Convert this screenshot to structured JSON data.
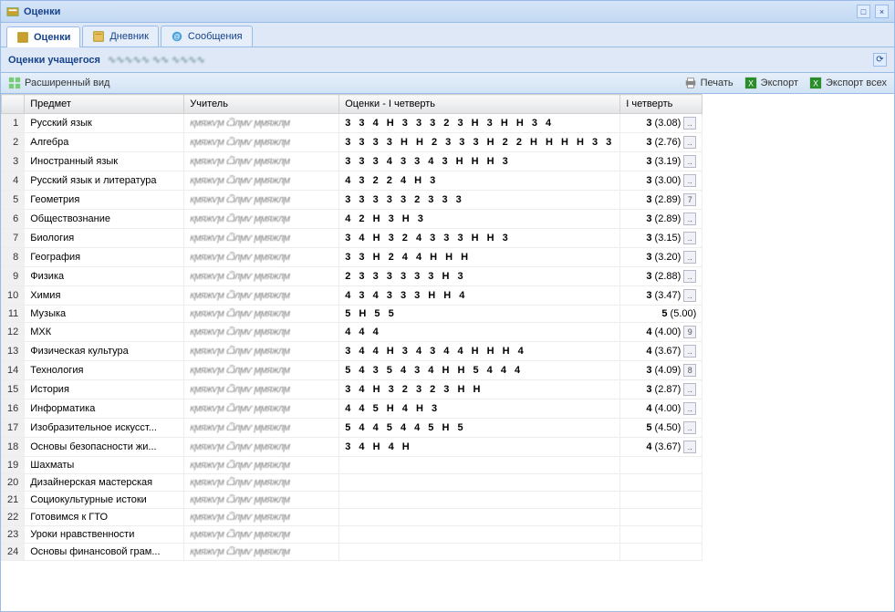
{
  "window_title": "Оценки",
  "tabs": [
    {
      "label": "Оценки",
      "active": true,
      "icon": "grades-icon"
    },
    {
      "label": "Дневник",
      "active": false,
      "icon": "diary-icon"
    },
    {
      "label": "Сообщения",
      "active": false,
      "icon": "messages-icon"
    }
  ],
  "subheader": "Оценки учащегося",
  "toolbar": {
    "expanded": "Расширенный вид",
    "print": "Печать",
    "export": "Экспорт",
    "export_all": "Экспорт всех"
  },
  "columns": {
    "subject": "Предмет",
    "teacher": "Учитель",
    "marks": "Оценки - I четверть",
    "quarter": "I четверть"
  },
  "rows": [
    {
      "n": 1,
      "subject": "Русский язык",
      "marks": "3 3 4 Н 3 3 3 2 3 Н 3 Н Н 3 4",
      "q": "3",
      "avg": "(3.08)",
      "ex": ".."
    },
    {
      "n": 2,
      "subject": "Алгебра",
      "marks": "3 3 3 3 Н Н 2 3 3 3 Н 2 2 Н Н Н Н 3 3",
      "q": "3",
      "avg": "(2.76)",
      "ex": ".."
    },
    {
      "n": 3,
      "subject": "Иностранный язык",
      "marks": "3 3 3 4 3 3 4 3 Н Н Н 3",
      "q": "3",
      "avg": "(3.19)",
      "ex": ".."
    },
    {
      "n": 4,
      "subject": "Русский язык и литература",
      "marks": "4 3 2 2 4 Н 3",
      "q": "3",
      "avg": "(3.00)",
      "ex": ".."
    },
    {
      "n": 5,
      "subject": "Геометрия",
      "marks": "3 3 3 3 3 2 3 3 3",
      "q": "3",
      "avg": "(2.89)",
      "ex": "7"
    },
    {
      "n": 6,
      "subject": "Обществознание",
      "marks": "4 2 Н 3 Н 3",
      "q": "3",
      "avg": "(2.89)",
      "ex": ".."
    },
    {
      "n": 7,
      "subject": "Биология",
      "marks": "3 4 Н 3 2 4 3 3 3 Н Н 3",
      "q": "3",
      "avg": "(3.15)",
      "ex": ".."
    },
    {
      "n": 8,
      "subject": "География",
      "marks": "3 3 Н 2 4 4 Н Н Н",
      "q": "3",
      "avg": "(3.20)",
      "ex": ".."
    },
    {
      "n": 9,
      "subject": "Физика",
      "marks": "2 3 3 3 3 3 3 Н 3",
      "q": "3",
      "avg": "(2.88)",
      "ex": ".."
    },
    {
      "n": 10,
      "subject": "Химия",
      "marks": "4 3 4 3 3 3 Н Н 4",
      "q": "3",
      "avg": "(3.47)",
      "ex": ".."
    },
    {
      "n": 11,
      "subject": "Музыка",
      "marks": "5 Н 5 5",
      "q": "5",
      "avg": "(5.00)",
      "ex": ""
    },
    {
      "n": 12,
      "subject": "МХК",
      "marks": "4 4 4",
      "q": "4",
      "avg": "(4.00)",
      "ex": "9"
    },
    {
      "n": 13,
      "subject": "Физическая культура",
      "marks": "3 4 4 Н 3 4 3 4 4 Н Н Н 4",
      "q": "4",
      "avg": "(3.67)",
      "ex": ".."
    },
    {
      "n": 14,
      "subject": "Технология",
      "marks": "5 4 3 5 4 3 4 Н Н 5 4 4 4",
      "q": "3",
      "avg": "(4.09)",
      "ex": "8"
    },
    {
      "n": 15,
      "subject": "История",
      "marks": "3 4 Н 3 2 3 2 3 Н Н",
      "q": "3",
      "avg": "(2.87)",
      "ex": ".."
    },
    {
      "n": 16,
      "subject": "Информатика",
      "marks": "4 4 5 Н 4 Н 3",
      "q": "4",
      "avg": "(4.00)",
      "ex": ".."
    },
    {
      "n": 17,
      "subject": "Изобразительное искусст...",
      "marks": "5 4 4 5 4 4 5 Н 5",
      "q": "5",
      "avg": "(4.50)",
      "ex": ".."
    },
    {
      "n": 18,
      "subject": "Основы безопасности жи...",
      "marks": "3 4 Н 4 Н",
      "q": "4",
      "avg": "(3.67)",
      "ex": ".."
    },
    {
      "n": 19,
      "subject": "Шахматы",
      "marks": "",
      "q": "",
      "avg": "",
      "ex": ""
    },
    {
      "n": 20,
      "subject": "Дизайнерская мастерская",
      "marks": "",
      "q": "",
      "avg": "",
      "ex": ""
    },
    {
      "n": 21,
      "subject": "Социокультурные истоки",
      "marks": "",
      "q": "",
      "avg": "",
      "ex": ""
    },
    {
      "n": 22,
      "subject": "Готовимся к ГТО",
      "marks": "",
      "q": "",
      "avg": "",
      "ex": ""
    },
    {
      "n": 23,
      "subject": "Уроки нравственности",
      "marks": "",
      "q": "",
      "avg": "",
      "ex": ""
    },
    {
      "n": 24,
      "subject": "Основы финансовой грам...",
      "marks": "",
      "q": "",
      "avg": "",
      "ex": ""
    }
  ]
}
